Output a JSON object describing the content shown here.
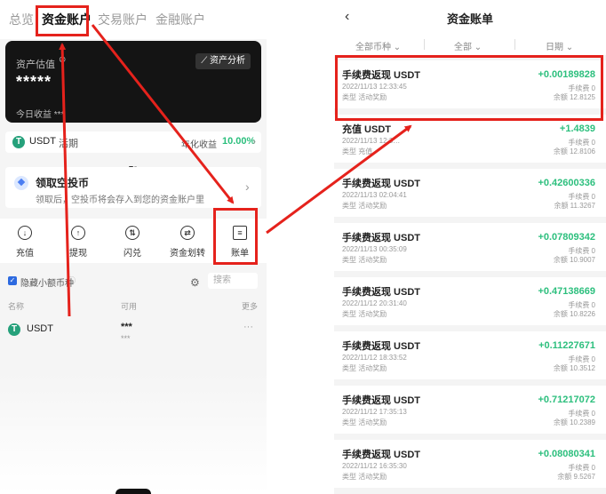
{
  "left": {
    "tabs": [
      "总览",
      "资金账户",
      "交易账户",
      "金融账户"
    ],
    "card": {
      "label": "资产估值",
      "masked_value": "*****",
      "today_label": "今日收益",
      "today_value": "***",
      "analysis_button": "资产分析"
    },
    "product": {
      "coin": "USDT",
      "term": "活期",
      "yield_label": "年化收益",
      "yield_value": "10.00%"
    },
    "airdrop": {
      "title": "领取空投币",
      "desc": "领取后，空投币将会存入到您的资金账户里"
    },
    "actions": [
      "充值",
      "提现",
      "闪兑",
      "资金划转",
      "账单"
    ],
    "filter": {
      "hide_small": "隐藏小额币种",
      "search_placeholder": "搜索"
    },
    "columns": {
      "name": "名称",
      "available": "可用",
      "more": "更多"
    },
    "asset": {
      "name": "USDT",
      "value": "***",
      "sub": "***",
      "more": "···"
    }
  },
  "right": {
    "title": "资金账单",
    "filters": [
      "全部币种",
      "全部",
      "日期"
    ],
    "records": [
      {
        "title": "手续费返现 USDT",
        "datetime": "2022/11/13 12:33:45",
        "type": "类型 活动奖励",
        "amount": "+0.00189828",
        "fee": "手续费 0",
        "balance": "余额 12.8125"
      },
      {
        "title": "充值 USDT",
        "datetime": "2022/11/13 12:3…",
        "type": "类型 充值",
        "amount": "+1.4839",
        "fee": "手续费 0",
        "balance": "余额 12.8106"
      },
      {
        "title": "手续费返现 USDT",
        "datetime": "2022/11/13 02:04:41",
        "type": "类型 活动奖励",
        "amount": "+0.42600336",
        "fee": "手续费 0",
        "balance": "余额 11.3267"
      },
      {
        "title": "手续费返现 USDT",
        "datetime": "2022/11/13 00:35:09",
        "type": "类型 活动奖励",
        "amount": "+0.07809342",
        "fee": "手续费 0",
        "balance": "余额 10.9007"
      },
      {
        "title": "手续费返现 USDT",
        "datetime": "2022/11/12 20:31:40",
        "type": "类型 活动奖励",
        "amount": "+0.47138669",
        "fee": "手续费 0",
        "balance": "余额 10.8226"
      },
      {
        "title": "手续费返现 USDT",
        "datetime": "2022/11/12 18:33:52",
        "type": "类型 活动奖励",
        "amount": "+0.11227671",
        "fee": "手续费 0",
        "balance": "余额 10.3512"
      },
      {
        "title": "手续费返现 USDT",
        "datetime": "2022/11/12 17:35:13",
        "type": "类型 活动奖励",
        "amount": "+0.71217072",
        "fee": "手续费 0",
        "balance": "余额 10.2389"
      },
      {
        "title": "手续费返现 USDT",
        "datetime": "2022/11/12 16:35:30",
        "type": "类型 活动奖励",
        "amount": "+0.08080341",
        "fee": "手续费 0",
        "balance": "余额 9.5267"
      }
    ]
  },
  "colors": {
    "accent_green": "#2cbf7d",
    "highlight_red": "#e5221c",
    "card_black": "#141414",
    "usdt_green": "#26a17b"
  },
  "icons": [
    "back-chevron-icon",
    "chart-icon",
    "usdt-coin-icon",
    "airdrop-diamond-icon",
    "deposit-icon",
    "withdraw-icon",
    "swap-icon",
    "transfer-icon",
    "bill-icon",
    "settings-icon",
    "eye-off-icon"
  ]
}
